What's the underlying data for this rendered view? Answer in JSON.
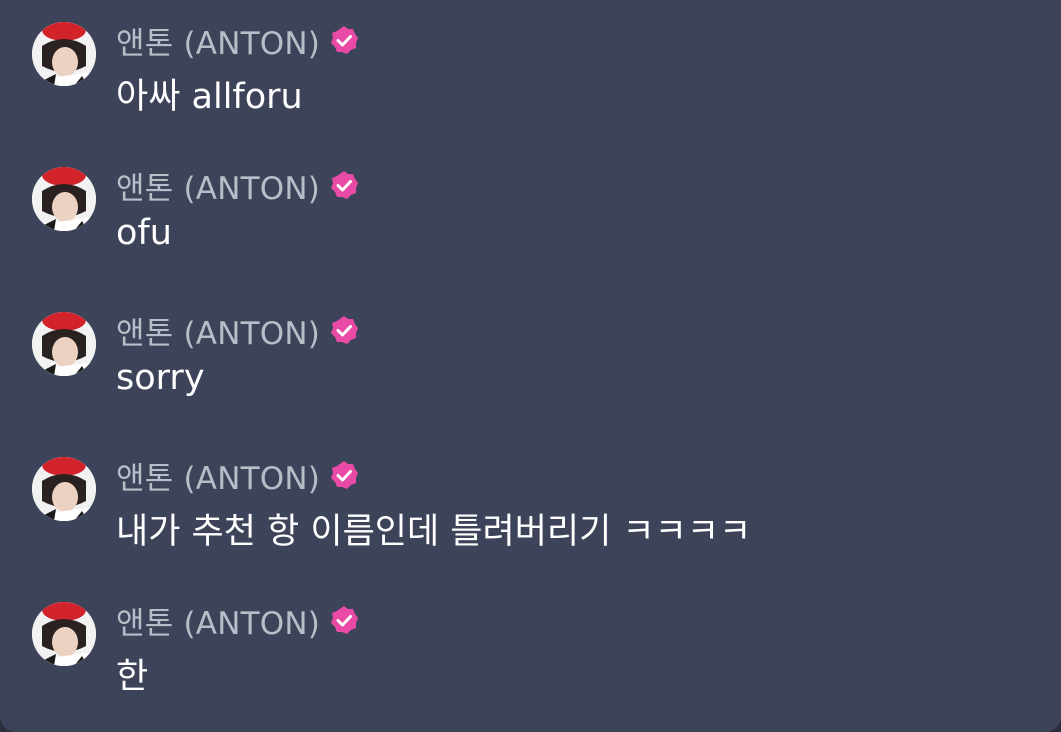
{
  "chat": {
    "messages": [
      {
        "sender": "앤톤 (ANTON)",
        "verified": true,
        "text": "아싸 allforu"
      },
      {
        "sender": "앤톤 (ANTON)",
        "verified": true,
        "text": "ofu"
      },
      {
        "sender": "앤톤 (ANTON)",
        "verified": true,
        "text": "sorry"
      },
      {
        "sender": "앤톤 (ANTON)",
        "verified": true,
        "text": "내가 추천 항 이름인데 틀려버리기 ㅋㅋㅋㅋ"
      },
      {
        "sender": "앤톤 (ANTON)",
        "verified": true,
        "text": "한"
      }
    ]
  },
  "colors": {
    "background": "#3d445a",
    "sender_name": "#b9bdc8",
    "message_text": "#ffffff",
    "verified_badge": "#e84aa5"
  },
  "icons": {
    "avatar": "profile-photo",
    "verified": "verified-badge-icon"
  }
}
